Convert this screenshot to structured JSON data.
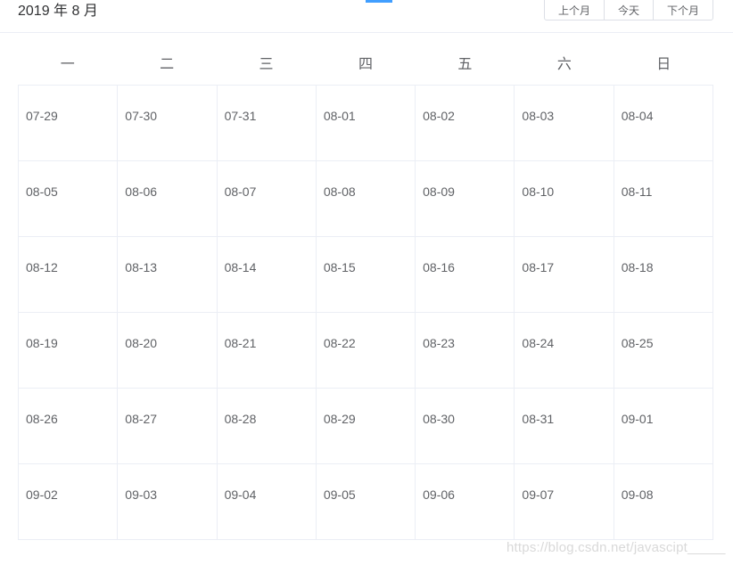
{
  "header": {
    "title": "2019 年 8 月",
    "prev_label": "上个月",
    "today_label": "今天",
    "next_label": "下个月"
  },
  "weekdays": [
    "一",
    "二",
    "三",
    "四",
    "五",
    "六",
    "日"
  ],
  "weeks": [
    [
      "07-29",
      "07-30",
      "07-31",
      "08-01",
      "08-02",
      "08-03",
      "08-04"
    ],
    [
      "08-05",
      "08-06",
      "08-07",
      "08-08",
      "08-09",
      "08-10",
      "08-11"
    ],
    [
      "08-12",
      "08-13",
      "08-14",
      "08-15",
      "08-16",
      "08-17",
      "08-18"
    ],
    [
      "08-19",
      "08-20",
      "08-21",
      "08-22",
      "08-23",
      "08-24",
      "08-25"
    ],
    [
      "08-26",
      "08-27",
      "08-28",
      "08-29",
      "08-30",
      "08-31",
      "09-01"
    ],
    [
      "09-02",
      "09-03",
      "09-04",
      "09-05",
      "09-06",
      "09-07",
      "09-08"
    ]
  ],
  "watermark": "https://blog.csdn.net/javascipt_____",
  "colors": {
    "accent": "#409eff",
    "border": "#ebeef5",
    "text": "#606266"
  }
}
